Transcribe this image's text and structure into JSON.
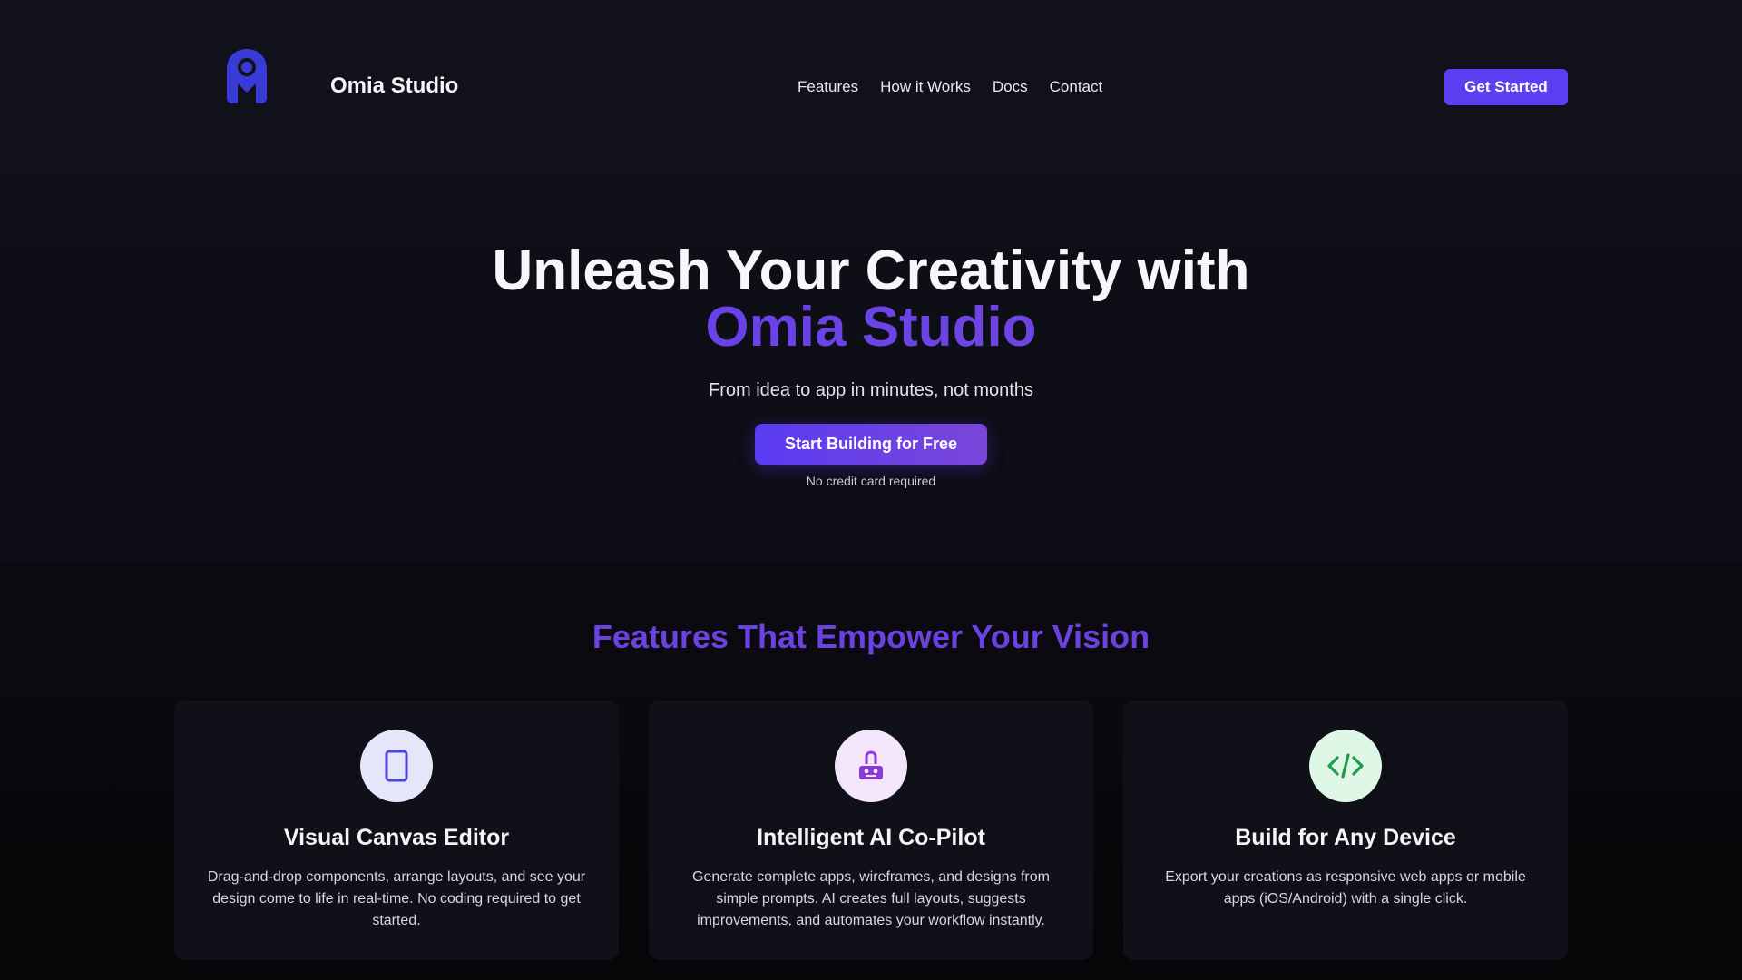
{
  "header": {
    "brand": "Omia Studio",
    "nav": [
      "Features",
      "How it Works",
      "Docs",
      "Contact"
    ],
    "cta": "Get Started",
    "logo_icon": "omia-logo-icon"
  },
  "hero": {
    "title_line1": "Unleash Your Creativity with",
    "title_line2": "Omia Studio",
    "subtitle": "From idea to app in minutes, not months",
    "cta": "Start Building for Free",
    "note": "No credit card required"
  },
  "features": {
    "title": "Features That Empower Your Vision",
    "cards": [
      {
        "icon": "tablet-icon",
        "title": "Visual Canvas Editor",
        "description": "Drag-and-drop components, arrange layouts, and see your design come to life in real-time. No coding required to get started."
      },
      {
        "icon": "robot-icon",
        "title": "Intelligent AI Co-Pilot",
        "description": "Generate complete apps, wireframes, and designs from simple prompts. AI creates full layouts, suggests improvements, and automates your workflow instantly."
      },
      {
        "icon": "code-icon",
        "title": "Build for Any Device",
        "description": "Export your creations as responsive web apps or mobile apps (iOS/Android) with a single click."
      }
    ]
  },
  "colors": {
    "accent": "#5b3ff0",
    "accent_purple": "#7d4ad6",
    "background": "#0b0b11",
    "card": "#101019"
  }
}
